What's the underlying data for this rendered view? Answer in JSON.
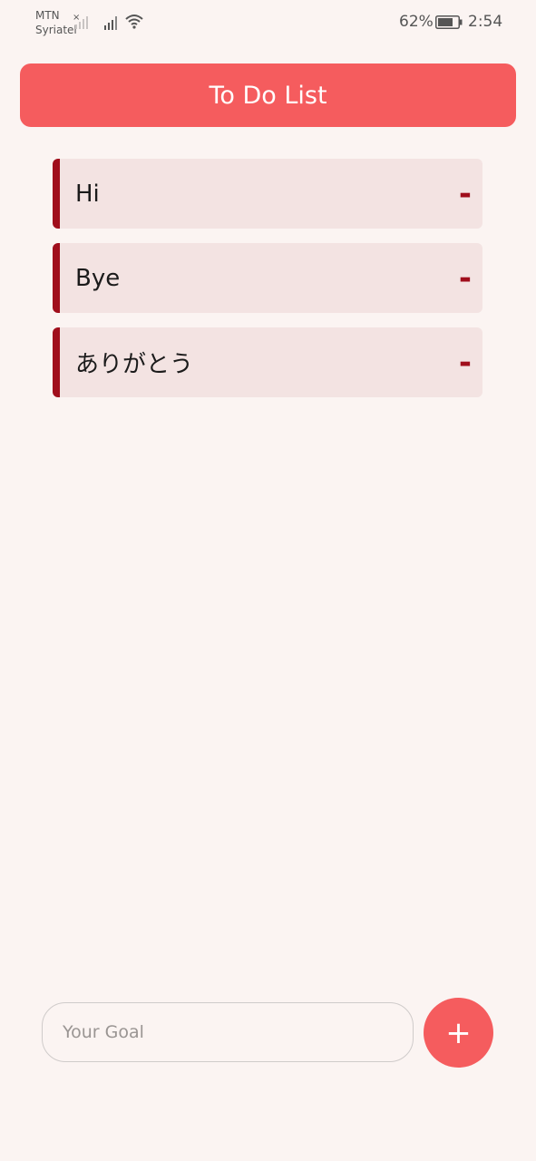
{
  "status_bar": {
    "carrier_1": "MTN",
    "carrier_2": "Syriatel",
    "battery_percent": "62%",
    "time": "2:54",
    "icons": [
      "signal-no-service-icon",
      "signal-icon",
      "wifi-icon",
      "battery-icon"
    ]
  },
  "header": {
    "title": "To Do List",
    "color": "#f55c5e"
  },
  "todos": [
    {
      "text": "Hi",
      "remove_label": "-"
    },
    {
      "text": "Bye",
      "remove_label": "-"
    },
    {
      "text": "ありがとう",
      "remove_label": "-"
    }
  ],
  "input": {
    "placeholder": "Your Goal",
    "value": ""
  },
  "add_button": {
    "label": "+",
    "icon": "plus-icon"
  },
  "colors": {
    "accent": "#f55c5e",
    "item_border": "#a00e1c",
    "item_bg": "#f3e3e2",
    "background": "#fbf4f2"
  }
}
